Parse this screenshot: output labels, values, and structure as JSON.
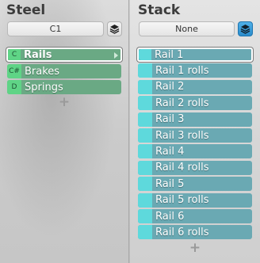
{
  "left": {
    "title": "Steel",
    "dropdown_value": "C1",
    "items": [
      {
        "key": "C",
        "label": "Rails"
      },
      {
        "key": "C#",
        "label": "Brakes"
      },
      {
        "key": "D",
        "label": "Springs"
      }
    ],
    "add_symbol": "+"
  },
  "right": {
    "title": "Stack",
    "dropdown_value": "None",
    "items": [
      "Rail 1",
      "Rail 1 rolls",
      "Rail 2",
      "Rail 2 rolls",
      "Rail 3",
      "Rail 3 rolls",
      "Rail 4",
      "Rail 4 rolls",
      "Rail 5",
      "Rail 5 rolls",
      "Rail 6",
      "Rail 6 rolls"
    ],
    "add_symbol": "+"
  },
  "colors": {
    "steel_item": "#6aa984",
    "steel_key": "#5fd486",
    "stack_item": "#6aa9b3",
    "stack_swatch": "#5ed9dc",
    "layer_active": "#3a9cda"
  },
  "icons": {
    "layers": "layers-icon",
    "arrow": "chevron-right-icon"
  }
}
